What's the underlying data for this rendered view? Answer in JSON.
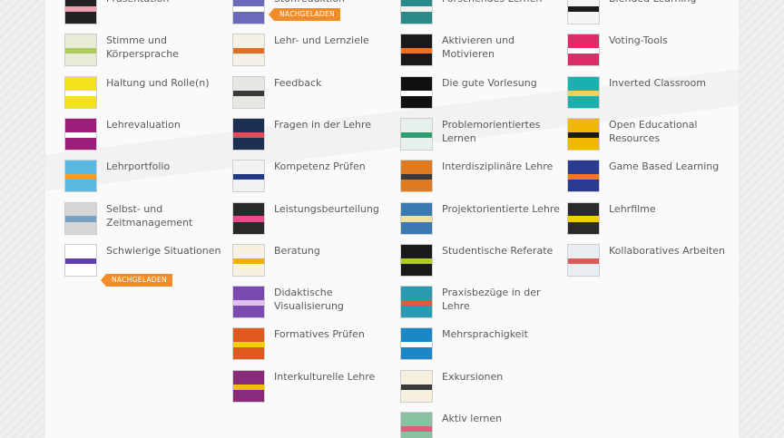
{
  "columns": [
    {
      "items": [
        {
          "label": "Präsentation",
          "color": "#222222",
          "accent": "#e9a0b0",
          "icon": "presentation-thumb"
        },
        {
          "label": "Stimme und Körpersprache",
          "color": "#e8ecd8",
          "accent": "#b0cc60",
          "icon": "voice-thumb"
        },
        {
          "label": "Haltung und Rolle(n)",
          "color": "#f2e21b",
          "accent": "#ffffff",
          "icon": "attitude-thumb"
        },
        {
          "label": "Lehrevaluation",
          "color": "#9a1f7a",
          "accent": "#ffffff",
          "icon": "evaluation-thumb"
        },
        {
          "label": "Lehrportfolio",
          "color": "#58b8e0",
          "accent": "#f0a030",
          "icon": "portfolio-thumb"
        },
        {
          "label": "Selbst- und Zeitmanagement",
          "color": "#d6d6d6",
          "accent": "#7aa0c0",
          "icon": "selfmanagement-thumb"
        },
        {
          "label": "Schwierige Situationen",
          "color": "#ffffff",
          "accent": "#5a3fb0",
          "icon": "situations-thumb",
          "badge": "NACHGELADEN"
        }
      ]
    },
    {
      "items": [
        {
          "label": "Stoffreduktion",
          "color": "#6a6ab8",
          "accent": "#ffffff",
          "icon": "reduction-thumb",
          "badge": "NACHGELADEN"
        },
        {
          "label": "Lehr- und Lernziele",
          "color": "#f4f0e6",
          "accent": "#e07020",
          "icon": "goals-thumb"
        },
        {
          "label": "Feedback",
          "color": "#e8e6e2",
          "accent": "#3a3a3a",
          "icon": "feedback-thumb"
        },
        {
          "label": "Fragen in der Lehre",
          "color": "#1e3050",
          "accent": "#e84a5a",
          "icon": "questions-thumb"
        },
        {
          "label": "Kompetenz Prüfen",
          "color": "#f2f2f2",
          "accent": "#223a80",
          "icon": "competence-thumb"
        },
        {
          "label": "Leistungsbeurteilung",
          "color": "#2a2a2a",
          "accent": "#e84a8a",
          "icon": "assessment-thumb"
        },
        {
          "label": "Beratung",
          "color": "#f5f0e0",
          "accent": "#f0b000",
          "icon": "consulting-thumb"
        },
        {
          "label": "Didaktische Visualisierung",
          "color": "#7a4ab0",
          "accent": "#e0c0f0",
          "icon": "visualization-thumb"
        },
        {
          "label": "Formatives Prüfen",
          "color": "#e05a20",
          "accent": "#f0d000",
          "icon": "formative-thumb"
        },
        {
          "label": "Interkulturelle Lehre",
          "color": "#8a2a7a",
          "accent": "#f0c000",
          "icon": "intercultural-thumb"
        }
      ]
    },
    {
      "items": [
        {
          "label": "Forschendes Lernen",
          "color": "#2a8a8a",
          "accent": "#f0f0f0",
          "icon": "research-thumb"
        },
        {
          "label": "Aktivieren und Motivieren",
          "color": "#1a1a1a",
          "accent": "#f07020",
          "icon": "activate-thumb"
        },
        {
          "label": "Die gute Vorlesung",
          "color": "#111111",
          "accent": "#ffffff",
          "icon": "lecture-thumb"
        },
        {
          "label": "Problemorientiertes Lernen",
          "color": "#e8f0ec",
          "accent": "#2aa070",
          "icon": "problem-thumb"
        },
        {
          "label": "Interdisziplinäre Lehre",
          "color": "#e07a20",
          "accent": "#3a3a3a",
          "icon": "interdisciplinary-thumb"
        },
        {
          "label": "Projektorientierte Lehre",
          "color": "#3a7ab0",
          "accent": "#f0e0a0",
          "icon": "project-thumb"
        },
        {
          "label": "Studentische Referate",
          "color": "#1a1a1a",
          "accent": "#b0d020",
          "icon": "presentations-thumb"
        },
        {
          "label": "Praxisbezüge in der Lehre",
          "color": "#2a9ab0",
          "accent": "#e05a40",
          "icon": "practice-thumb"
        },
        {
          "label": "Mehrsprachigkeit",
          "color": "#1a88c8",
          "accent": "#ffffff",
          "icon": "multilingual-thumb"
        },
        {
          "label": "Exkursionen",
          "color": "#f5efe0",
          "accent": "#3a3a3a",
          "icon": "excursions-thumb"
        },
        {
          "label": "Aktiv lernen",
          "color": "#8ac0a0",
          "accent": "#e05a7a",
          "icon": "activelearning-thumb"
        }
      ]
    },
    {
      "items": [
        {
          "label": "Blended Learning",
          "color": "#f5f5f5",
          "accent": "#1a1a1a",
          "icon": "blended-thumb"
        },
        {
          "label": "Voting-Tools",
          "color": "#e02a6a",
          "accent": "#ffffff",
          "icon": "voting-thumb"
        },
        {
          "label": "Inverted Classroom",
          "color": "#1ab0b0",
          "accent": "#f0d060",
          "icon": "inverted-thumb"
        },
        {
          "label": "Open Educational Resources",
          "color": "#f0b800",
          "accent": "#1a1a1a",
          "icon": "oer-thumb"
        },
        {
          "label": "Game Based Learning",
          "color": "#2a3a90",
          "accent": "#f07a20",
          "icon": "game-thumb"
        },
        {
          "label": "Lehrfilme",
          "color": "#2a2a2a",
          "accent": "#f0d000",
          "icon": "films-thumb"
        },
        {
          "label": "Kollaboratives Arbeiten",
          "color": "#e8eef2",
          "accent": "#e05a5a",
          "icon": "collaborative-thumb"
        }
      ]
    }
  ]
}
